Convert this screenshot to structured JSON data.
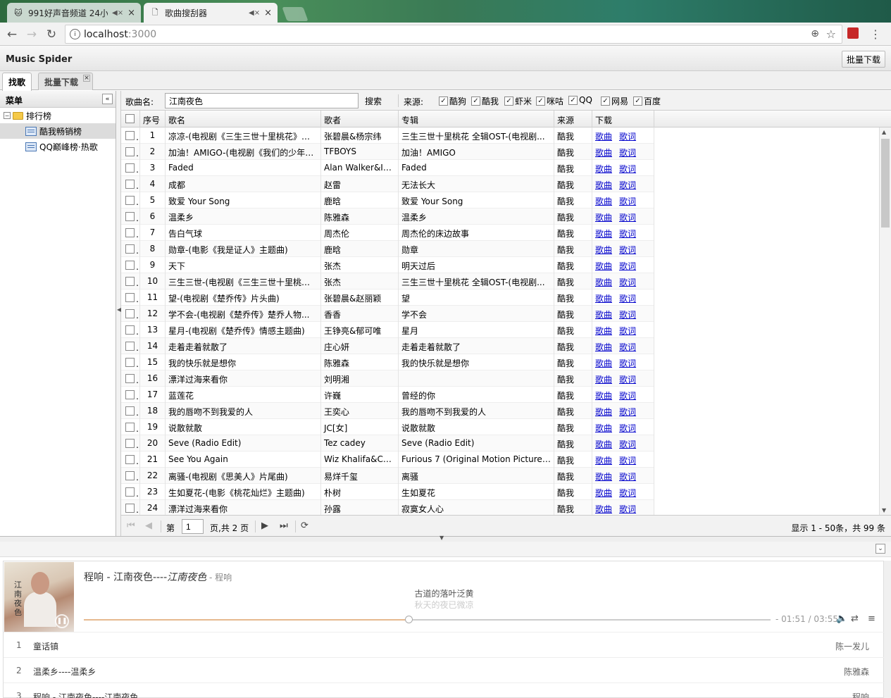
{
  "browser": {
    "tabs": [
      {
        "title": "991好声音频道 24小",
        "mute": "◀×",
        "close": "×"
      },
      {
        "title": "歌曲搜刮器",
        "mute": "◀×",
        "close": "×"
      }
    ],
    "url_host": "localhost",
    "url_port": ":3000"
  },
  "app": {
    "title": "Music Spider",
    "batch_button": "批量下载",
    "tabs": [
      {
        "label": "找歌"
      },
      {
        "label": "批量下载"
      }
    ]
  },
  "sidebar": {
    "title": "菜单",
    "root": "排行榜",
    "items": [
      {
        "label": "酷我畅销榜"
      },
      {
        "label": "QQ巅峰榜·热歌"
      }
    ]
  },
  "search": {
    "label": "歌曲名:",
    "value": "江南夜色",
    "button": "搜索",
    "source_label": "来源:",
    "sources": [
      {
        "label": "酷狗",
        "checked": true
      },
      {
        "label": "酷我",
        "checked": true
      },
      {
        "label": "虾米",
        "checked": true
      },
      {
        "label": "咪咕",
        "checked": true
      },
      {
        "label": "QQ",
        "checked": true
      },
      {
        "label": "网易",
        "checked": true
      },
      {
        "label": "百度",
        "checked": true
      }
    ]
  },
  "grid": {
    "columns": [
      "序号",
      "歌名",
      "歌者",
      "专辑",
      "来源",
      "下载"
    ],
    "song_link": "歌曲",
    "lyric_link": "歌词",
    "rows": [
      {
        "n": "1",
        "name": "凉凉-(电视剧《三生三世十里桃花》片尾曲)",
        "singer": "张碧晨&杨宗纬",
        "album": "三生三世十里桃花 全辑OST-(电视剧...",
        "src": "酷我"
      },
      {
        "n": "2",
        "name": "加油！AMIGO-(电视剧《我们的少年时代》...",
        "singer": "TFBOYS",
        "album": "加油！AMIGO",
        "src": "酷我"
      },
      {
        "n": "3",
        "name": "Faded",
        "singer": "Alan Walker&Is...",
        "album": "Faded",
        "src": "酷我"
      },
      {
        "n": "4",
        "name": "成都",
        "singer": "赵雷",
        "album": "无法长大",
        "src": "酷我"
      },
      {
        "n": "5",
        "name": "致爱 Your Song",
        "singer": "鹿晗",
        "album": "致爱 Your Song",
        "src": "酷我"
      },
      {
        "n": "6",
        "name": "温柔乡",
        "singer": "陈雅森",
        "album": "温柔乡",
        "src": "酷我"
      },
      {
        "n": "7",
        "name": "告白气球",
        "singer": "周杰伦",
        "album": "周杰伦的床边故事",
        "src": "酷我"
      },
      {
        "n": "8",
        "name": "勋章-(电影《我是证人》主题曲)",
        "singer": "鹿晗",
        "album": "勋章",
        "src": "酷我"
      },
      {
        "n": "9",
        "name": "天下",
        "singer": "张杰",
        "album": "明天过后",
        "src": "酷我"
      },
      {
        "n": "10",
        "name": "三生三世-(电视剧《三生三世十里桃花》...",
        "singer": "张杰",
        "album": "三生三世十里桃花 全辑OST-(电视剧...",
        "src": "酷我"
      },
      {
        "n": "11",
        "name": "望-(电视剧《楚乔传》片头曲)",
        "singer": "张碧晨&赵丽颖",
        "album": "望",
        "src": "酷我"
      },
      {
        "n": "12",
        "name": "学不会-(电视剧《楚乔传》楚乔人物...",
        "singer": "香香",
        "album": "学不会",
        "src": "酷我"
      },
      {
        "n": "13",
        "name": "星月-(电视剧《楚乔传》情感主题曲)",
        "singer": "王铮亮&郁可唯",
        "album": "星月",
        "src": "酷我"
      },
      {
        "n": "14",
        "name": "走着走着就散了",
        "singer": "庄心妍",
        "album": "走着走着就散了",
        "src": "酷我"
      },
      {
        "n": "15",
        "name": "我的快乐就是想你",
        "singer": "陈雅森",
        "album": "我的快乐就是想你",
        "src": "酷我"
      },
      {
        "n": "16",
        "name": "漂洋过海来看你",
        "singer": "刘明湘",
        "album": "",
        "src": "酷我"
      },
      {
        "n": "17",
        "name": "蓝莲花",
        "singer": "许巍",
        "album": "曾经的你",
        "src": "酷我"
      },
      {
        "n": "18",
        "name": "我的唇吻不到我爱的人",
        "singer": "王奕心",
        "album": "我的唇吻不到我爱的人",
        "src": "酷我"
      },
      {
        "n": "19",
        "name": "说散就散",
        "singer": "JC[女]",
        "album": "说散就散",
        "src": "酷我"
      },
      {
        "n": "20",
        "name": "Seve (Radio Edit)",
        "singer": "Tez cadey",
        "album": "Seve (Radio Edit)",
        "src": "酷我"
      },
      {
        "n": "21",
        "name": "See You Again",
        "singer": "Wiz Khalifa&Ch...",
        "album": "Furious 7 (Original Motion Picture S...",
        "src": "酷我"
      },
      {
        "n": "22",
        "name": "离骚-(电视剧《思美人》片尾曲)",
        "singer": "易烊千玺",
        "album": "离骚",
        "src": "酷我"
      },
      {
        "n": "23",
        "name": "生如夏花-(电影《桃花灿烂》主题曲)",
        "singer": "朴树",
        "album": "生如夏花",
        "src": "酷我"
      },
      {
        "n": "24",
        "name": "漂洋过海来看你",
        "singer": "孙露",
        "album": "寂寞女人心",
        "src": "酷我"
      }
    ]
  },
  "pager": {
    "page_prefix": "第",
    "page_value": "1",
    "page_suffix": "页,共 2 页",
    "info": "显示 1 - 50条，共 99 条"
  },
  "player": {
    "title": "程响 - 江南夜色----",
    "album": "江南夜色",
    "artist_suffix": " - 程响",
    "lyric_current": "古道的落叶泛黄",
    "lyric_next": "秋天的夜已微凉",
    "time": "- 01:51 / 03:55",
    "progress": 0.473,
    "cover_text": "江南夜色",
    "playlist": [
      {
        "n": "1",
        "title": "童话镇",
        "artist": "陈一发儿"
      },
      {
        "n": "2",
        "title": "温柔乡----温柔乡",
        "artist": "陈雅森"
      },
      {
        "n": "3",
        "title": "程响 - 江南夜色----江南夜色",
        "artist": "程响"
      }
    ]
  }
}
